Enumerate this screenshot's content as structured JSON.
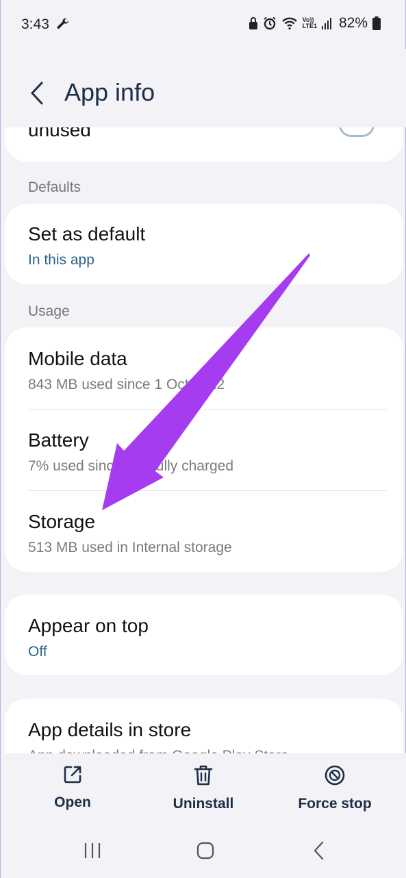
{
  "status_bar": {
    "time": "3:43",
    "battery_percent": "82%",
    "network_label_top": "Vo))",
    "network_label_bottom": "LTE1"
  },
  "header": {
    "title": "App info"
  },
  "partial_item": {
    "title": "unused"
  },
  "sections": {
    "defaults": "Defaults",
    "usage": "Usage"
  },
  "items": {
    "set_default": {
      "title": "Set as default",
      "subtitle": "In this app"
    },
    "mobile_data": {
      "title": "Mobile data",
      "subtitle": "843 MB used since 1 Oct 2022"
    },
    "battery": {
      "title": "Battery",
      "subtitle": "7% used since last fully charged"
    },
    "storage": {
      "title": "Storage",
      "subtitle": "513 MB used in Internal storage"
    },
    "appear_on_top": {
      "title": "Appear on top",
      "subtitle": "Off"
    },
    "app_details": {
      "title": "App details in store",
      "subtitle": "App downloaded from Google Play Store"
    }
  },
  "actions": {
    "open": "Open",
    "uninstall": "Uninstall",
    "force_stop": "Force stop"
  },
  "colors": {
    "accent_blue": "#2a6189",
    "title_navy": "#1d2e45",
    "annotation_arrow": "#a53cf0"
  }
}
